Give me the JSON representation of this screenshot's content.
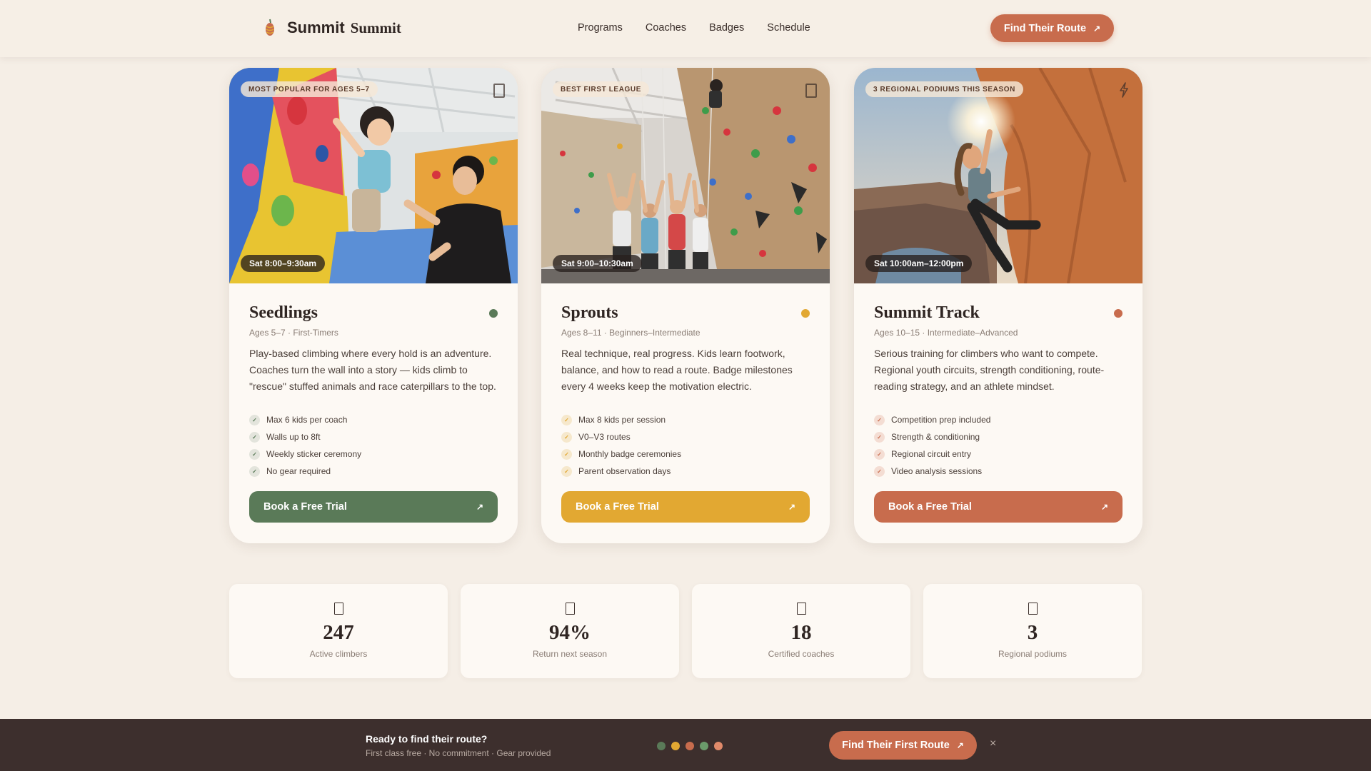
{
  "nav": {
    "brand": "Summit",
    "brand_serif": "Summit",
    "links": [
      "Programs",
      "Coaches",
      "Badges",
      "Schedule"
    ],
    "cta": "Find Their Route",
    "cta_icon": "arrow-up-right-icon",
    "accent": "#c86c4d"
  },
  "programs": [
    {
      "badge": "MOST POPULAR FOR AGES 5–7",
      "time": "Sat 8:00–9:30am",
      "title": "Seedlings",
      "subtitle": "Ages 5–7 · First-Timers",
      "description": "Play-based climbing where every hold is an adventure. Coaches turn the wall into a story — kids climb to \"rescue\" stuffed animals and race caterpillars to the top.",
      "features": [
        "Max 6 kids per coach",
        "Walls up to 8ft",
        "Weekly sticker ceremony",
        "No gear required"
      ],
      "cta": "Book a Free Trial",
      "color": "#5a7a58",
      "icon": "bookmark-icon"
    },
    {
      "badge": "BEST FIRST LEAGUE",
      "time": "Sat 9:00–10:30am",
      "title": "Sprouts",
      "subtitle": "Ages 8–11 · Beginners–Intermediate",
      "description": "Real technique, real progress. Kids learn footwork, balance, and how to read a route. Badge milestones every 4 weeks keep the motivation electric.",
      "features": [
        "Max 8 kids per session",
        "V0–V3 routes",
        "Monthly badge ceremonies",
        "Parent observation days"
      ],
      "cta": "Book a Free Trial",
      "color": "#e2a832",
      "icon": "bookmark-icon"
    },
    {
      "badge": "3 REGIONAL PODIUMS THIS SEASON",
      "time": "Sat 10:00am–12:00pm",
      "title": "Summit Track",
      "subtitle": "Ages 10–15 · Intermediate–Advanced",
      "description": "Serious training for climbers who want to compete. Regional youth circuits, strength conditioning, route-reading strategy, and an athlete mindset.",
      "features": [
        "Competition prep included",
        "Strength & conditioning",
        "Regional circuit entry",
        "Video analysis sessions"
      ],
      "cta": "Book a Free Trial",
      "color": "#c86c4d",
      "icon": "bolt-icon"
    }
  ],
  "stats": [
    {
      "value": "247",
      "label": "Active climbers"
    },
    {
      "value": "94%",
      "label": "Return next season"
    },
    {
      "value": "18",
      "label": "Certified coaches"
    },
    {
      "value": "3",
      "label": "Regional podiums"
    }
  ],
  "bottom_bar": {
    "title": "Ready to find their route?",
    "subtitle": "First class free · No commitment · Gear provided",
    "dots": [
      "#5a7a58",
      "#e2a832",
      "#c86c4d",
      "#6b9b6b",
      "#e08a6a"
    ],
    "cta": "Find Their First Route",
    "close": "×"
  }
}
